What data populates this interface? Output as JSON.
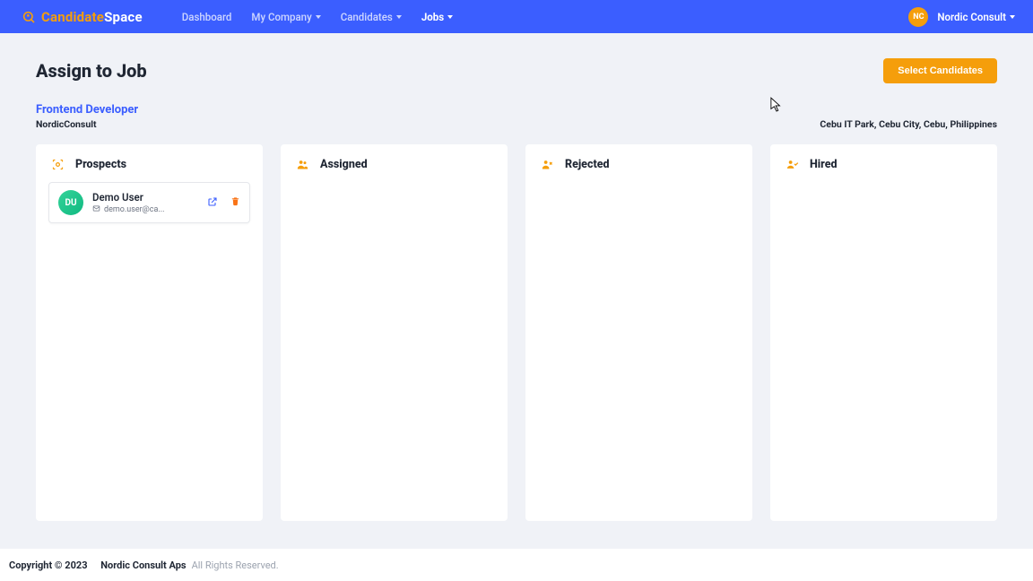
{
  "brand": {
    "part1": "Candidate",
    "part2": "Space"
  },
  "nav": {
    "dashboard": "Dashboard",
    "my_company": "My Company",
    "candidates": "Candidates",
    "jobs": "Jobs"
  },
  "user": {
    "badge": "NC",
    "name": "Nordic Consult"
  },
  "page": {
    "title": "Assign to Job",
    "select_btn": "Select Candidates"
  },
  "job": {
    "title": "Frontend Developer",
    "company": "NordicConsult",
    "location": "Cebu IT Park, Cebu City, Cebu, Philippines"
  },
  "columns": {
    "prospects": "Prospects",
    "assigned": "Assigned",
    "rejected": "Rejected",
    "hired": "Hired"
  },
  "candidate": {
    "initials": "DU",
    "name": "Demo User",
    "email": "demo.user@ca..."
  },
  "footer": {
    "copyright": "Copyright © 2023",
    "company": "Nordic Consult Aps",
    "rights": "All Rights Reserved."
  }
}
